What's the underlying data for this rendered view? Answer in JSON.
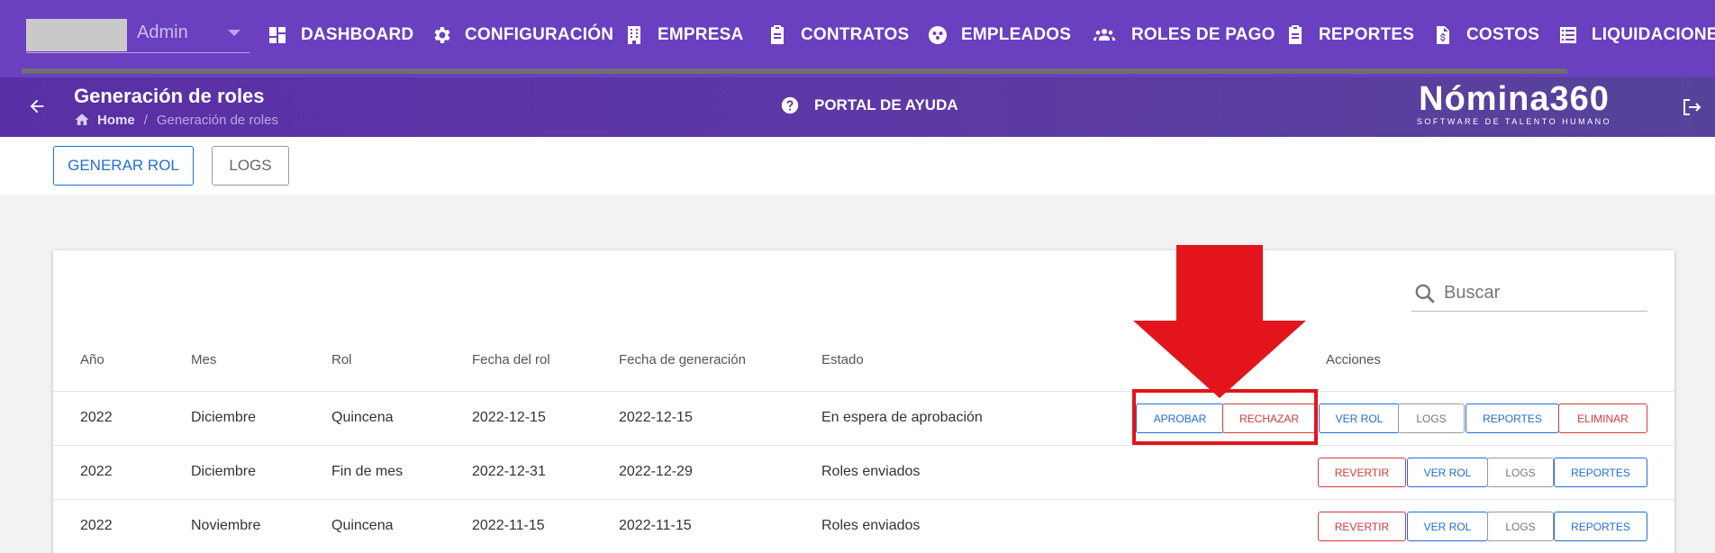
{
  "user": {
    "name": "Admin"
  },
  "nav": {
    "items": [
      {
        "label": "DASHBOARD",
        "icon": "dashboard-icon"
      },
      {
        "label": "CONFIGURACIÓN",
        "icon": "gear-icon"
      },
      {
        "label": "EMPRESA",
        "icon": "building-icon"
      },
      {
        "label": "CONTRATOS",
        "icon": "clipboard-icon"
      },
      {
        "label": "EMPLEADOS",
        "icon": "people-icon"
      },
      {
        "label": "ROLES DE PAGO",
        "icon": "group-icon"
      },
      {
        "label": "REPORTES",
        "icon": "clipboard-icon"
      },
      {
        "label": "COSTOS",
        "icon": "dollar-file-icon"
      },
      {
        "label": "LIQUIDACIONES",
        "icon": "list-icon"
      }
    ]
  },
  "header": {
    "title": "Generación de roles",
    "breadcrumb": {
      "home": "Home",
      "separator": "/",
      "current": "Generación de roles"
    },
    "help_label": "PORTAL DE AYUDA",
    "brand": {
      "name": "Nómina360",
      "tagline": "SOFTWARE DE TALENTO HUMANO"
    }
  },
  "toolbar": {
    "generate_label": "GENERAR ROL",
    "logs_label": "LOGS"
  },
  "search": {
    "placeholder": "Buscar"
  },
  "table": {
    "columns": [
      "Año",
      "Mes",
      "Rol",
      "Fecha del rol",
      "Fecha de generación",
      "Estado",
      "Acciones"
    ],
    "rows": [
      {
        "anio": "2022",
        "mes": "Diciembre",
        "rol": "Quincena",
        "fecha_rol": "2022-12-15",
        "fecha_generacion": "2022-12-15",
        "estado": "En espera de aprobación",
        "actions": [
          "APROBAR",
          "RECHAZAR",
          "VER ROL",
          "LOGS",
          "REPORTES",
          "ELIMINAR"
        ]
      },
      {
        "anio": "2022",
        "mes": "Diciembre",
        "rol": "Fin de mes",
        "fecha_rol": "2022-12-31",
        "fecha_generacion": "2022-12-29",
        "estado": "Roles enviados",
        "actions": [
          "REVERTIR",
          "VER ROL",
          "LOGS",
          "REPORTES"
        ]
      },
      {
        "anio": "2022",
        "mes": "Noviembre",
        "rol": "Quincena",
        "fecha_rol": "2022-11-15",
        "fecha_generacion": "2022-11-15",
        "estado": "Roles enviados",
        "actions": [
          "REVERTIR",
          "VER ROL",
          "LOGS",
          "REPORTES"
        ]
      }
    ]
  },
  "colors": {
    "nav_bg": "#6a3fc0",
    "primary_blue": "#1e6fd6",
    "danger_red": "#d63a3a",
    "annotation_red": "#e3141c"
  }
}
